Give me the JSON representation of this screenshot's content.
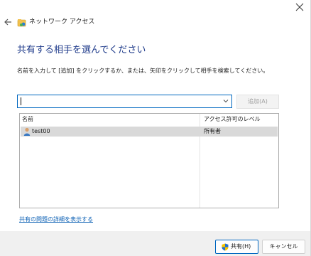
{
  "window": {
    "title": "ネットワーク アクセス",
    "back_icon": "back-arrow-icon",
    "app_icon": "network-access-icon",
    "close_icon": "close-icon"
  },
  "heading": "共有する相手を選んでください",
  "instruction": "名前を入力して [追加] をクリックするか、または、矢印をクリックして相手を検索してください。",
  "combo": {
    "value": "",
    "placeholder": ""
  },
  "add_button": {
    "label": "追加(A)",
    "enabled": false
  },
  "list": {
    "columns": [
      "名前",
      "アクセス許可のレベル"
    ],
    "rows": [
      {
        "name": "test00",
        "level": "所有者",
        "icon": "user-icon",
        "selected": true
      }
    ]
  },
  "help_link": "共有の問題の詳細を表示する",
  "footer": {
    "share_label": "共有(H)",
    "share_icon": "uac-shield-icon",
    "cancel_label": "キャンセル"
  },
  "colors": {
    "heading": "#1e3a8a",
    "accent": "#0067c0",
    "link": "#0a5fb4",
    "selected_row": "#d9d9d9",
    "footer_bg": "#f0f0f0"
  }
}
